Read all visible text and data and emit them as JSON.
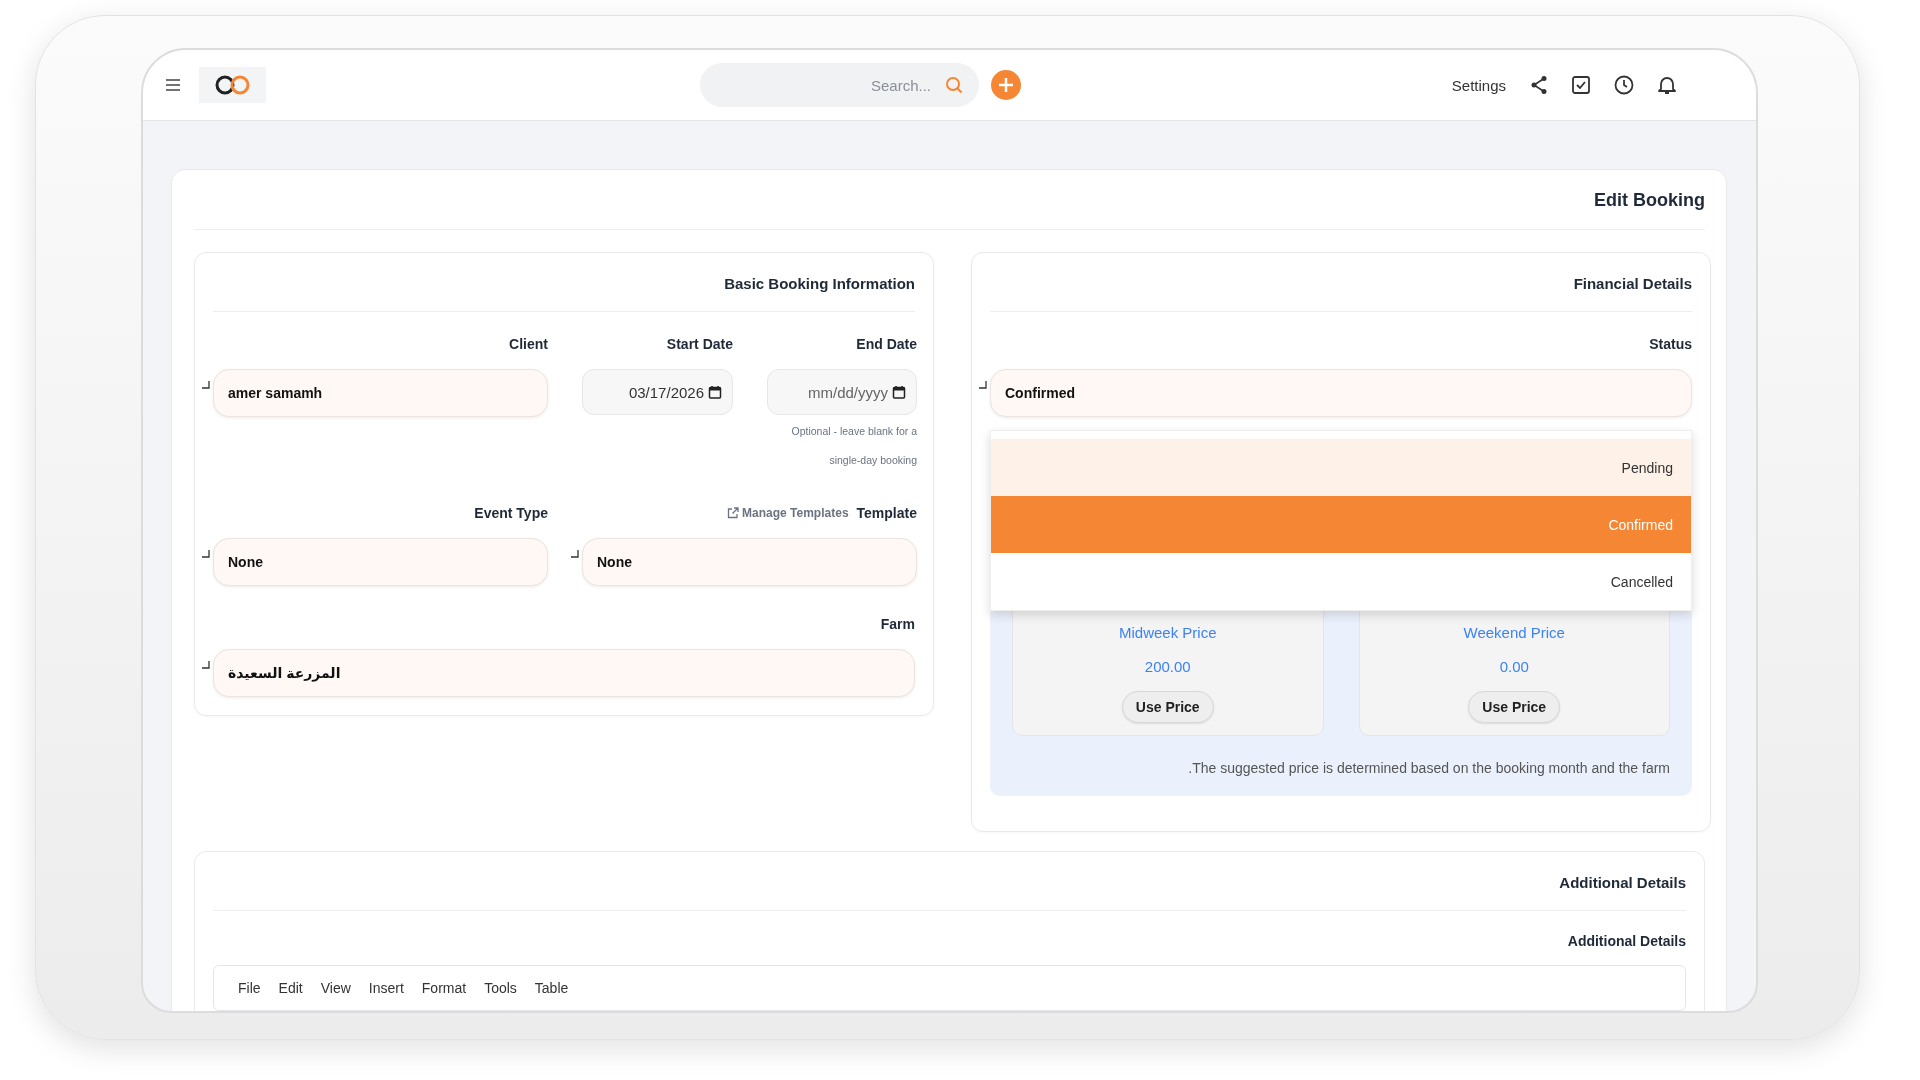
{
  "header": {
    "search": {
      "placeholder": "Search..."
    },
    "settings_label": "Settings"
  },
  "page_title": "Edit Booking",
  "basic_info": {
    "title": "Basic Booking Information",
    "client": {
      "label": "Client",
      "value": "amer samamh"
    },
    "start_date": {
      "label": "Start Date",
      "value": "03/17/2026"
    },
    "end_date": {
      "label": "End Date",
      "placeholder": "mm/dd/yyyy",
      "hint": "Optional - leave blank for a single-day booking"
    },
    "event_type": {
      "label": "Event Type",
      "value": "None"
    },
    "template": {
      "label": "Template",
      "link": "Manage Templates",
      "value": "None"
    },
    "farm": {
      "label": "Farm",
      "value": "المزرعة السعيدة"
    }
  },
  "financial": {
    "title": "Financial Details",
    "status": {
      "label": "Status",
      "value": "Confirmed",
      "options": [
        {
          "label": "Pending",
          "selected": false,
          "hovered": true
        },
        {
          "label": "Confirmed",
          "selected": true,
          "hovered": false
        },
        {
          "label": "Cancelled",
          "selected": false,
          "hovered": false
        }
      ]
    },
    "prices": [
      {
        "label": "Midweek Price",
        "value": "200.00",
        "button": "Use Price"
      },
      {
        "label": "Weekend Price",
        "value": "0.00",
        "button": "Use Price"
      }
    ],
    "note": ".The suggested price is determined based on the booking month and the farm"
  },
  "additional": {
    "title": "Additional Details",
    "label": "Additional Details",
    "menu": [
      "File",
      "Edit",
      "View",
      "Insert",
      "Format",
      "Tools",
      "Table"
    ]
  }
}
